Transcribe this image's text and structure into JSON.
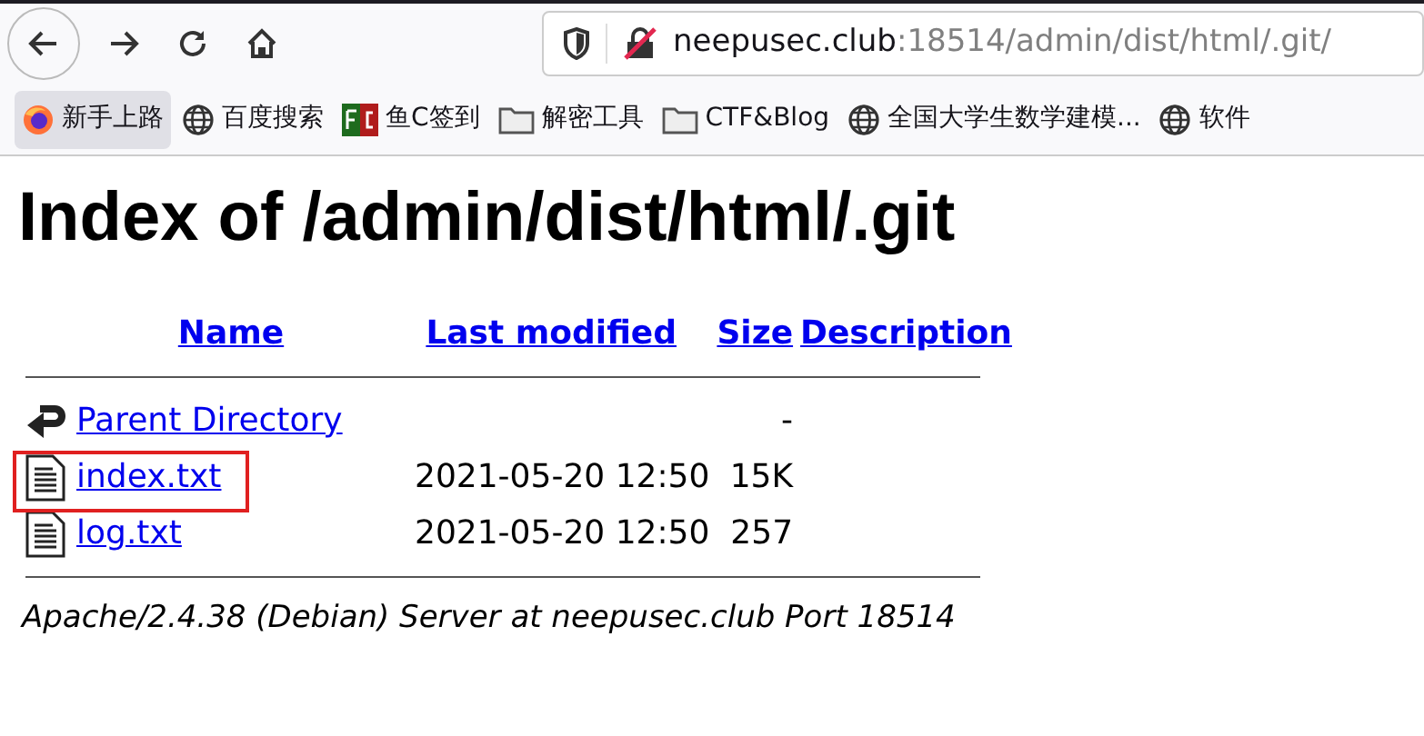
{
  "toolbar": {
    "url_host": "neepusec.club",
    "url_path": ":18514/admin/dist/html/.git/"
  },
  "bookmarks": [
    {
      "kind": "firefox",
      "label": "新手上路",
      "selected": true
    },
    {
      "kind": "globe",
      "label": "百度搜索",
      "selected": false
    },
    {
      "kind": "fc",
      "label": "鱼C签到",
      "selected": false
    },
    {
      "kind": "folder",
      "label": "解密工具",
      "selected": false
    },
    {
      "kind": "folder",
      "label": "CTF&Blog",
      "selected": false
    },
    {
      "kind": "globe",
      "label": "全国大学生数学建模...",
      "selected": false
    },
    {
      "kind": "globe",
      "label": "软件",
      "selected": false
    }
  ],
  "page": {
    "title": "Index of /admin/dist/html/.git",
    "columns": [
      "Name",
      "Last modified",
      "Size",
      "Description"
    ],
    "rows": [
      {
        "kind": "back",
        "name": "Parent Directory",
        "modified": "",
        "size": "-",
        "highlighted": false
      },
      {
        "kind": "text",
        "name": "index.txt",
        "modified": "2021-05-20 12:50",
        "size": "15K",
        "highlighted": true
      },
      {
        "kind": "text",
        "name": "log.txt",
        "modified": "2021-05-20 12:50",
        "size": "257",
        "highlighted": false
      }
    ],
    "address": "Apache/2.4.38 (Debian) Server at neepusec.club Port 18514"
  }
}
